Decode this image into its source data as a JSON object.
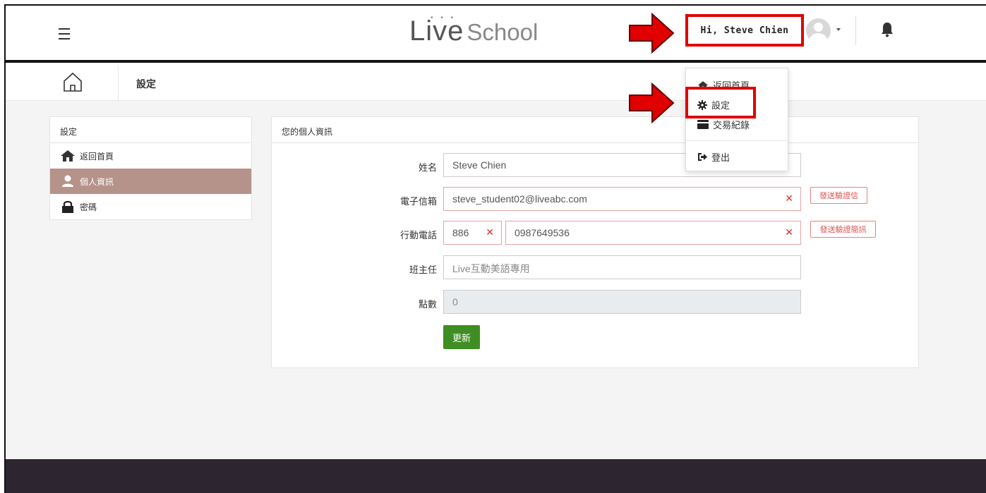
{
  "header": {
    "logo_live": "Live",
    "logo_school": "School",
    "greeting": "Hi, Steve Chien"
  },
  "breadcrumb": {
    "title": "設定"
  },
  "sidebar": {
    "heading": "設定",
    "items": [
      {
        "label": "返回首頁",
        "icon": "home-icon"
      },
      {
        "label": "個人資訊",
        "icon": "user-icon",
        "active": true
      },
      {
        "label": "密碼",
        "icon": "lock-icon"
      }
    ]
  },
  "profile": {
    "heading": "您的個人資訊",
    "name_label": "姓名",
    "name_value": "Steve Chien",
    "email_label": "電子信箱",
    "email_value": "steve_student02@liveabc.com",
    "email_verify": "發送驗證信",
    "phone_label": "行動電話",
    "phone_code": "886",
    "phone_value": "0987649536",
    "phone_verify": "發送驗證簡訊",
    "teacher_label": "班主任",
    "teacher_placeholder": "Live互動美語專用",
    "points_label": "點數",
    "points_value": "0",
    "update_button": "更新"
  },
  "dropdown": {
    "items": [
      {
        "label": "返回首頁",
        "icon": "home-icon"
      },
      {
        "label": "設定",
        "icon": "gear-icon"
      },
      {
        "label": "交易紀錄",
        "icon": "credit-card-icon"
      },
      {
        "label": "登出",
        "icon": "sign-out-icon"
      }
    ]
  },
  "colors": {
    "highlight": "#e00000",
    "sidebar_active": "#b5928a",
    "update_button": "#3f8e23",
    "footer": "#2d2630",
    "error_red": "#d9302c"
  }
}
